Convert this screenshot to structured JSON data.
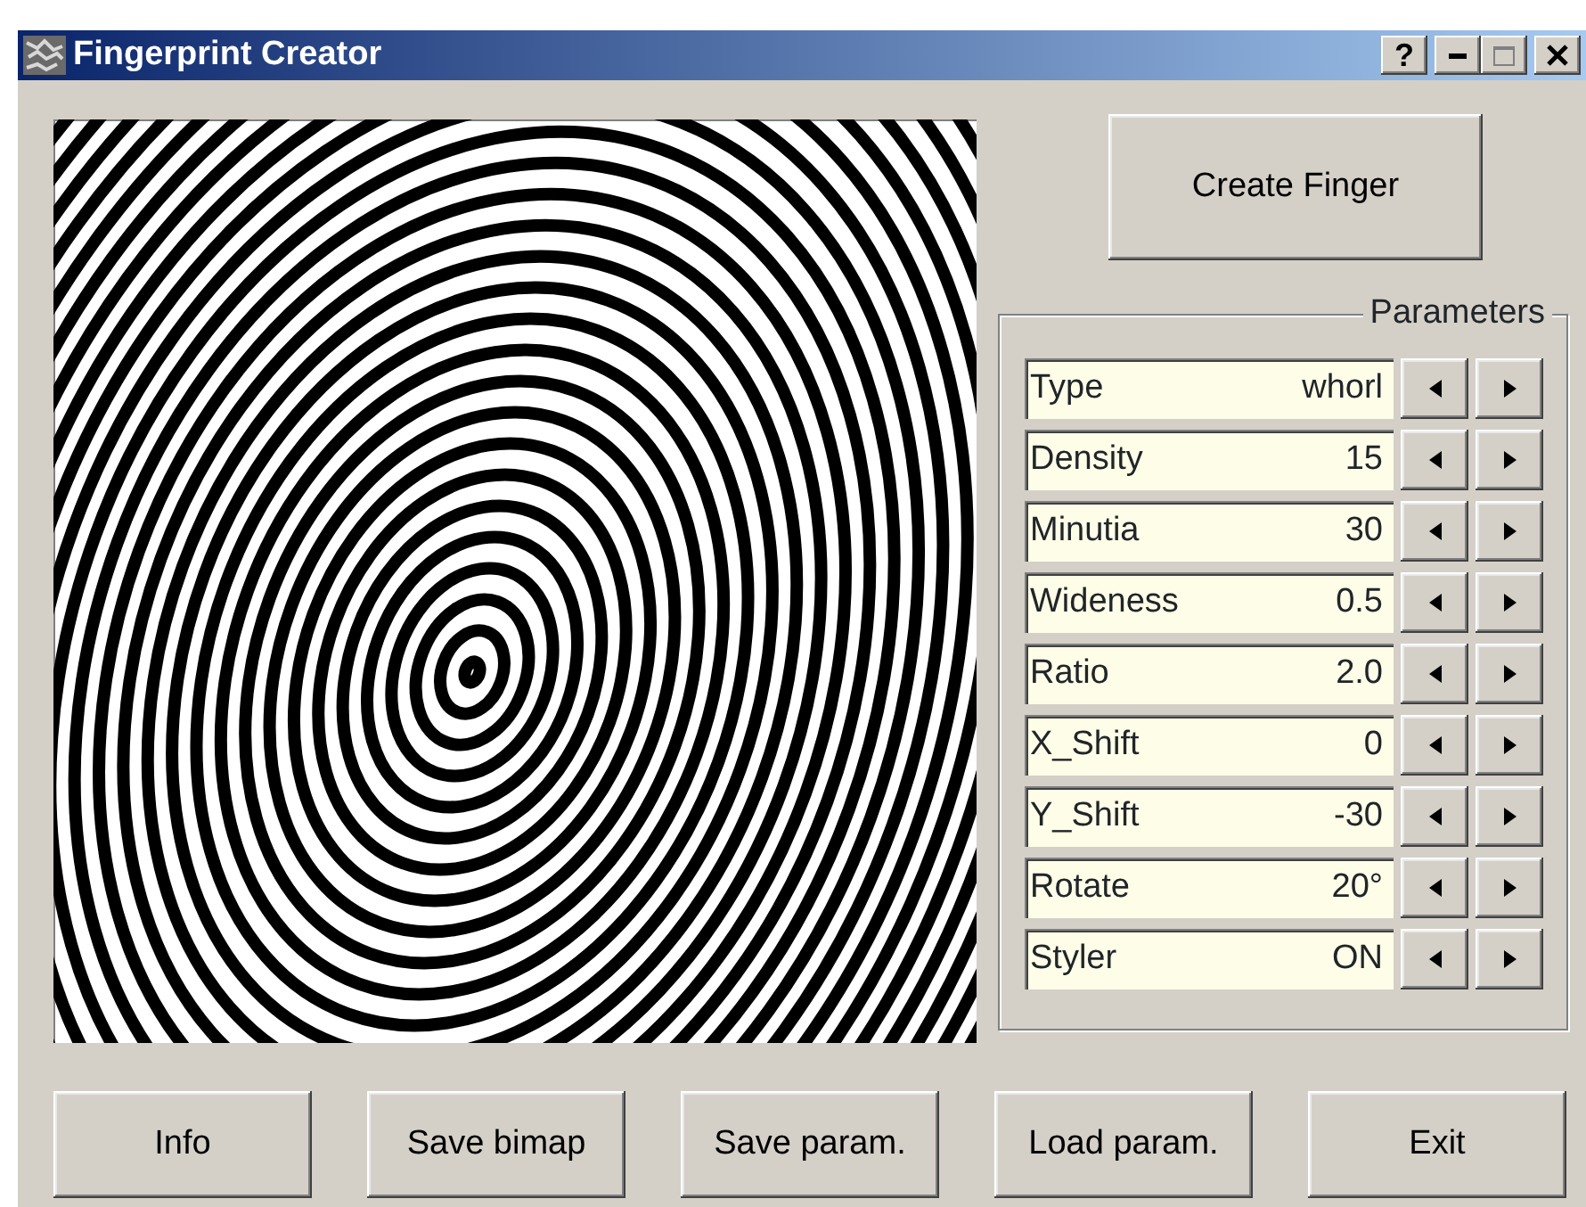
{
  "window": {
    "title": "Fingerprint Creator",
    "help_button": "?"
  },
  "create_button": "Create Finger",
  "parameters": {
    "title": "Parameters",
    "rows": [
      {
        "label": "Type",
        "value": "whorl"
      },
      {
        "label": "Density",
        "value": "15"
      },
      {
        "label": "Minutia",
        "value": "30"
      },
      {
        "label": "Wideness",
        "value": "0.5"
      },
      {
        "label": "Ratio",
        "value": "2.0"
      },
      {
        "label": "X_Shift",
        "value": "0"
      },
      {
        "label": "Y_Shift",
        "value": "-30"
      },
      {
        "label": "Rotate",
        "value": "20°"
      },
      {
        "label": "Styler",
        "value": "ON"
      }
    ]
  },
  "buttons": [
    "Info",
    "Save bimap",
    "Save param.",
    "Load param.",
    "Exit"
  ]
}
